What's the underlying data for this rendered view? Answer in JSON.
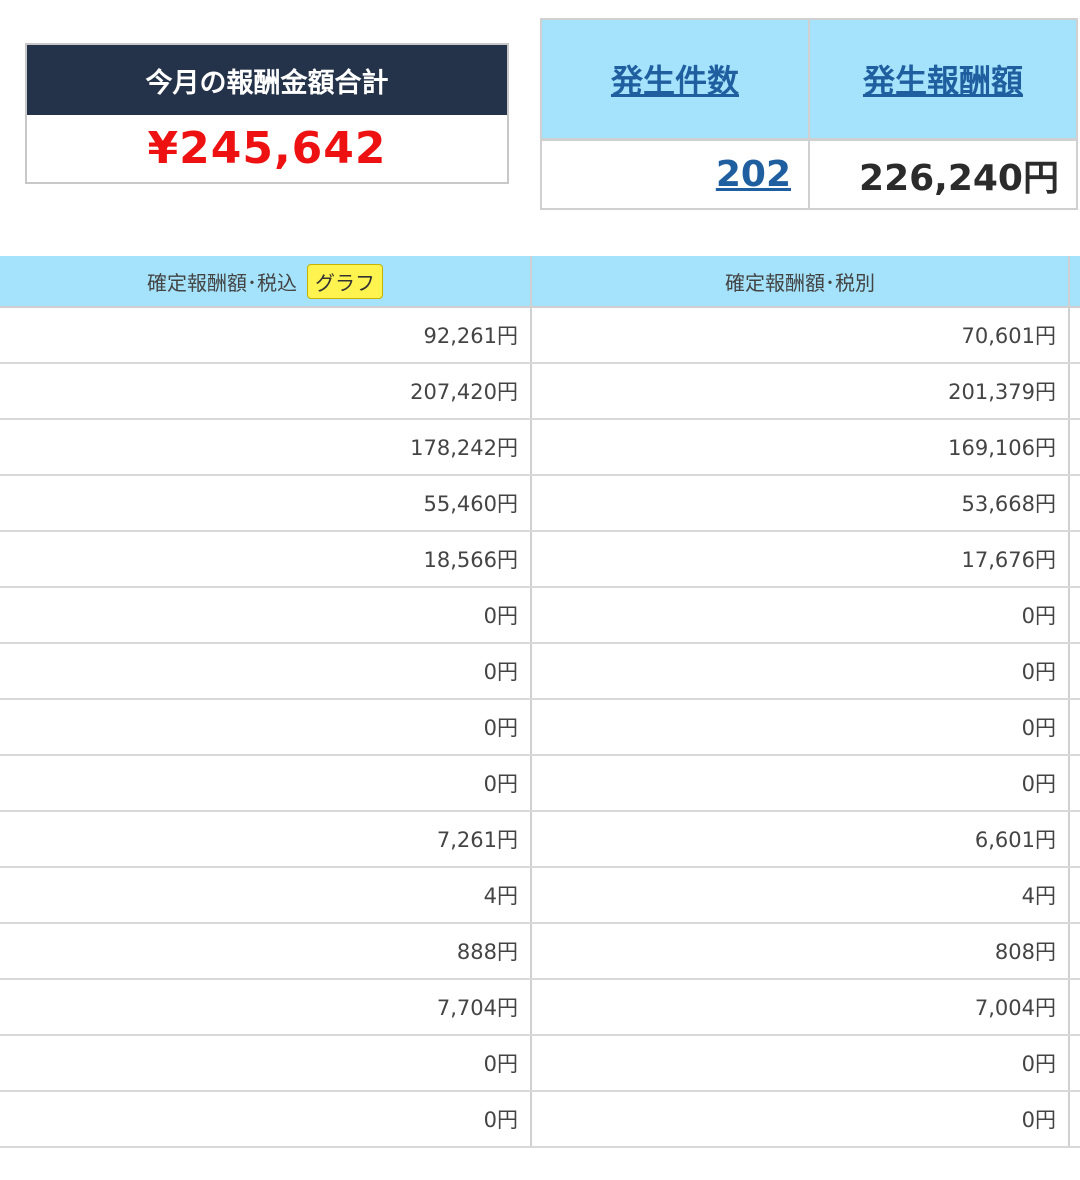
{
  "total_box": {
    "title": "今月の報酬金額合計",
    "amount": "¥245,642"
  },
  "summary": {
    "headers": [
      "発生件数",
      "発生報酬額"
    ],
    "count": "202",
    "reward": "226,240円"
  },
  "table": {
    "headers": {
      "with_tax": "確定報酬額･税込",
      "graph_button": "グラフ",
      "without_tax": "確定報酬額･税別"
    },
    "rows": [
      [
        "92,261円",
        "70,601円"
      ],
      [
        "207,420円",
        "201,379円"
      ],
      [
        "178,242円",
        "169,106円"
      ],
      [
        "55,460円",
        "53,668円"
      ],
      [
        "18,566円",
        "17,676円"
      ],
      [
        "0円",
        "0円"
      ],
      [
        "0円",
        "0円"
      ],
      [
        "0円",
        "0円"
      ],
      [
        "0円",
        "0円"
      ],
      [
        "7,261円",
        "6,601円"
      ],
      [
        "4円",
        "4円"
      ],
      [
        "888円",
        "808円"
      ],
      [
        "7,704円",
        "7,004円"
      ],
      [
        "0円",
        "0円"
      ],
      [
        "0円",
        "0円"
      ]
    ]
  },
  "colors": {
    "header_navy": "#243349",
    "total_red": "#ee1111",
    "header_light_blue": "#a4e3fb",
    "link_blue": "#1f5fa0",
    "graph_button_yellow": "#fff44f"
  }
}
